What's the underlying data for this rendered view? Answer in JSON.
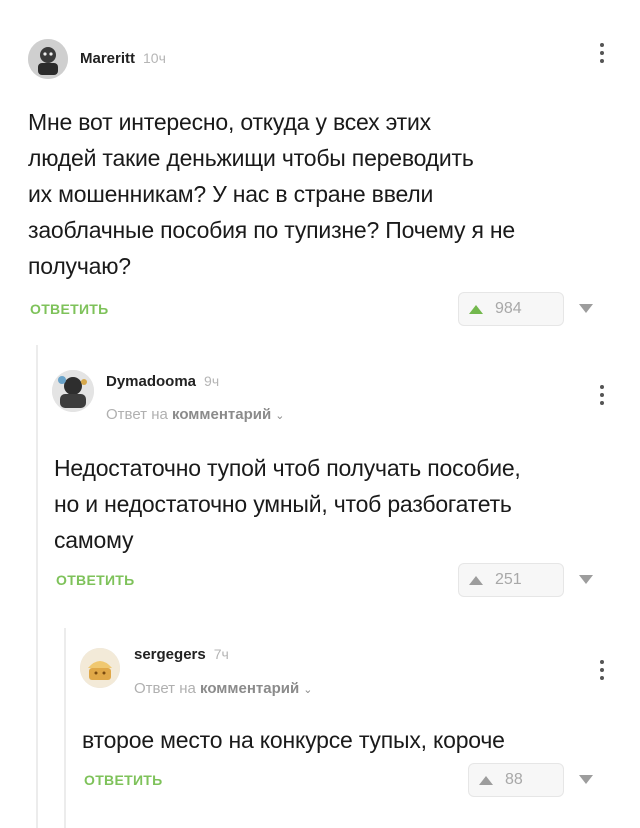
{
  "comments": [
    {
      "author": "Mareritt",
      "time": "10ч",
      "text_lines": [
        "Мне вот интересно, откуда у всех этих",
        "людей такие деньжищи чтобы переводить",
        "их мошенникам? У нас в стране ввели",
        "заоблачные пособия по тупизне? Почему я не",
        "получаю?"
      ],
      "reply_label": "ОТВЕТИТЬ",
      "score": "984"
    },
    {
      "author": "Dymadooma",
      "time": "9ч",
      "reply_to_prefix": "Ответ на",
      "reply_to_link": "комментарий",
      "text_lines": [
        "Недостаточно тупой чтоб получать пособие,",
        "но и недостаточно умный, чтоб разбогатеть",
        "самому"
      ],
      "reply_label": "ОТВЕТИТЬ",
      "score": "251"
    },
    {
      "author": "sergegers",
      "time": "7ч",
      "reply_to_prefix": "Ответ на",
      "reply_to_link": "комментарий",
      "text_lines": [
        "второе место на конкурсе тупых, короче"
      ],
      "reply_label": "ОТВЕТИТЬ",
      "score": "88"
    }
  ],
  "icons": {
    "menu": "more-vertical-icon",
    "upvote": "arrow-up-icon",
    "downvote": "arrow-down-icon",
    "chevron": "chevron-down-icon"
  },
  "colors": {
    "accent": "#7ec25a",
    "upvote": "#73b84d",
    "muted": "#b0b0b0"
  }
}
